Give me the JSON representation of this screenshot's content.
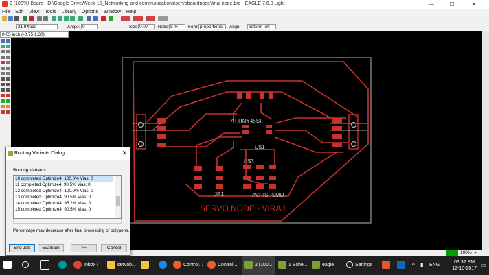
{
  "window": {
    "title": "2 (100%) Board - D:\\Google Drive\\Week 15_Networking and communications\\servoboardnode\\final node.brd - EAGLE 7.6.0 Light",
    "minimize": "—",
    "maximize": "☐",
    "close": "✕"
  },
  "menu": [
    "File",
    "Edit",
    "View",
    "Tools",
    "Library",
    "Options",
    "Window",
    "Help"
  ],
  "params": {
    "layer": "21 tPlace",
    "angle_label": "Angle:",
    "angle": "0",
    "size_label": "Size:",
    "size": "0.07",
    "ratio_label": "Ratio:",
    "ratio": "8 %",
    "font_label": "Font:",
    "font": "proportional",
    "align_label": "Align:",
    "align": "bottom-left"
  },
  "coordinate": "0.05 inch (-0.75 1.30)",
  "board": {
    "title": "SERVO NODE - VIRAJ",
    "labels": [
      "ATTINY45SI",
      "U$1",
      "U$3",
      "JP1",
      "AVRISPSMD"
    ]
  },
  "dialog": {
    "title": "Routing Variants Dialog",
    "section": "Routing Variants",
    "rows": [
      {
        "text": "10 completed Optimize4: 100.0% Vias: 0",
        "selected": true
      },
      {
        "text": "11 completed Optimize4: 90.5% Vias: 0",
        "selected": false
      },
      {
        "text": "12 completed Optimize4: 100.0% Vias: 0",
        "selected": false
      },
      {
        "text": "13 completed Optimize4: 90.5% Vias: 0",
        "selected": false
      },
      {
        "text": "14 completed Optimize4: 95.2% Vias: 0",
        "selected": false
      },
      {
        "text": "15 completed Optimize4: 90.5% Vias: 0",
        "selected": false
      }
    ],
    "note": "Percentage may decrease after final processing of polygons.",
    "buttons": {
      "end": "End Job",
      "evaluate": "Evaluate",
      "next": ">>",
      "cancel": "Cancel"
    }
  },
  "status": {
    "zoom": "100%"
  },
  "taskbar": {
    "items": [
      "Inbox (",
      "servob...",
      "Control...",
      "Control...",
      "2 (100...",
      "1 Sche...",
      "eagle",
      "Settings"
    ],
    "lang": "ENG",
    "time": "03:32 PM",
    "date": "12-10-2017"
  },
  "colors": {
    "trace": "#c8322e",
    "outline": "#9a9a9a",
    "silk": "#c8c8c8",
    "route_green": "#00a000"
  }
}
